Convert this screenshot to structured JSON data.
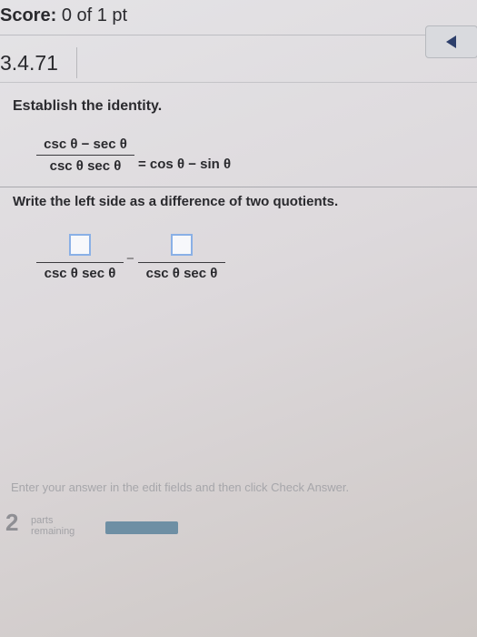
{
  "header": {
    "score_label": "Score:",
    "score_value": "0 of 1 pt",
    "question_number": "3.4.71",
    "nav_icon": "left-arrow-icon"
  },
  "problem": {
    "instruction": "Establish the identity.",
    "identity": {
      "lhs_numerator": "csc θ − sec θ",
      "lhs_denominator": "csc θ sec θ",
      "rhs": "= cos θ − sin θ"
    }
  },
  "task": {
    "instruction": "Write the left side as a difference of two quotients.",
    "fraction1_denominator": "csc θ sec θ",
    "operator": "−",
    "fraction2_denominator": "csc θ sec θ"
  },
  "footer": {
    "hint": "Enter your answer in the edit fields and then click Check Answer.",
    "parts_count": "2",
    "parts_word": "parts",
    "remaining_word": "remaining",
    "progress_fraction": 0.0
  }
}
